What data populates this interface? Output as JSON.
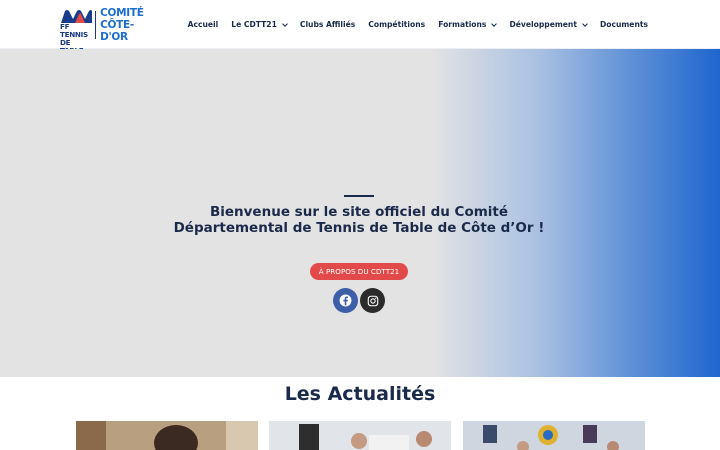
{
  "logo": {
    "mark_text": "FF TENNIS DE TABLE",
    "mark_line1": "FF TENNIS",
    "mark_line2": "DE TABLE",
    "title_line1": "COMITÉ",
    "title_line2": "CÔTE-D'OR"
  },
  "nav": {
    "items": [
      {
        "label": "Accueil",
        "has_dropdown": false
      },
      {
        "label": "Le CDTT21",
        "has_dropdown": true
      },
      {
        "label": "Clubs Affiliés",
        "has_dropdown": false
      },
      {
        "label": "Compétitions",
        "has_dropdown": false
      },
      {
        "label": "Formations",
        "has_dropdown": true
      },
      {
        "label": "Développement",
        "has_dropdown": true
      },
      {
        "label": "Documents",
        "has_dropdown": false
      }
    ]
  },
  "hero": {
    "title_line1": "Bienvenue sur le site officiel du Comité",
    "title_line2": "Départemental de Tennis de Table de Côte d’Or !",
    "button_label": "À PROPOS DU CDTT21",
    "social": [
      {
        "icon": "facebook-icon"
      },
      {
        "icon": "instagram-icon"
      }
    ]
  },
  "news": {
    "title": "Les Actualités"
  },
  "colors": {
    "brand_blue": "#1a6fd0",
    "navy": "#1a2a4a",
    "button_red": "#e24a4a",
    "facebook": "#3c5fa8",
    "instagram": "#2b2b2b"
  }
}
